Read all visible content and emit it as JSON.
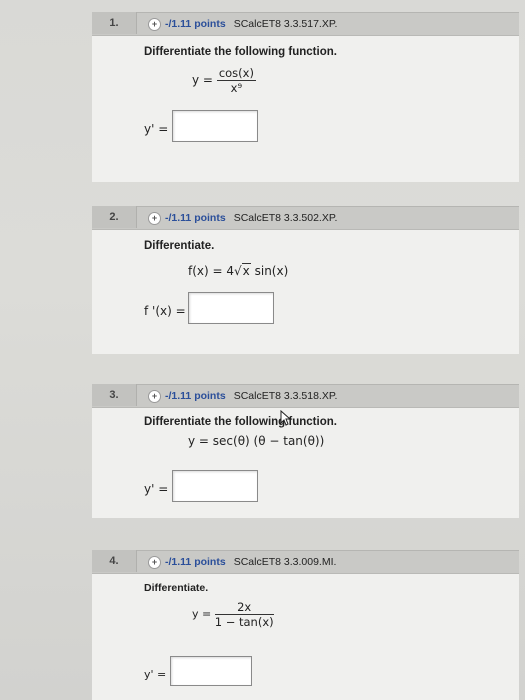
{
  "questions": [
    {
      "number": "1.",
      "points": "-/1.11 points",
      "source": "SCalcET8 3.3.517.XP.",
      "prompt": "Differentiate the following function.",
      "lhs": "y =",
      "numerator": "cos(x)",
      "denominator": "x⁹",
      "answer_label": "y' ="
    },
    {
      "number": "2.",
      "points": "-/1.11 points",
      "source": "SCalcET8 3.3.502.XP.",
      "prompt": "Differentiate.",
      "lhs": "f(x) = 4",
      "radicand": "x",
      "rhs": "sin(x)",
      "answer_label": "f '(x) ="
    },
    {
      "number": "3.",
      "points": "-/1.11 points",
      "source": "SCalcET8 3.3.518.XP.",
      "prompt": "Differentiate the following function.",
      "equation": "y = sec(θ) (θ − tan(θ))",
      "answer_label": "y' ="
    },
    {
      "number": "4.",
      "points": "-/1.11 points",
      "source": "SCalcET8 3.3.009.MI.",
      "prompt": "Differentiate.",
      "lhs": "y =",
      "numerator": "2x",
      "denominator": "1 − tan(x)",
      "answer_label": "y' ="
    }
  ],
  "plus_glyph": "+"
}
